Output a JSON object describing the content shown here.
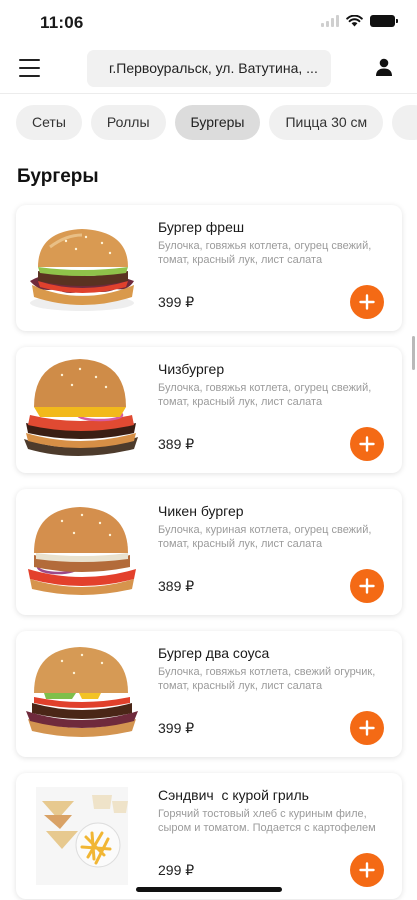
{
  "status_bar": {
    "time": "11:06",
    "icons": [
      "signal-icon",
      "wifi-icon",
      "battery-icon"
    ]
  },
  "header": {
    "menu_icon": "hamburger-menu-icon",
    "address": "г.Первоуральск, ул. Ватутина, ...",
    "profile_icon": "user-icon"
  },
  "categories": [
    {
      "label": "Сеты",
      "active": false
    },
    {
      "label": "Роллы",
      "active": false
    },
    {
      "label": "Бургеры",
      "active": true
    },
    {
      "label": "Пицца 30 см",
      "active": false
    },
    {
      "label": "",
      "active": false
    }
  ],
  "section": {
    "title": "Бургеры"
  },
  "products": [
    {
      "name": "Бургер фреш",
      "description": "Булочка, говяжья котлета, огурец свежий, томат, красный лук, лист салата",
      "price": "399 ₽",
      "image": "burger-photo"
    },
    {
      "name": "Чизбургер",
      "description": "Булочка, говяжья котлета, огурец свежий, томат, красный лук, лист салата",
      "price": "389 ₽",
      "image": "cheeseburger-photo"
    },
    {
      "name": "Чикен бургер",
      "description": "Булочка, куриная котлета, огурец свежий, томат, красный лук, лист салата",
      "price": "389 ₽",
      "image": "chicken-burger-photo"
    },
    {
      "name": "Бургер два соуса",
      "description": "Булочка, говяжья котлета, свежий огурчик, томат, красный лук, лист салата",
      "price": "399 ₽",
      "image": "two-sauce-burger-photo"
    },
    {
      "name": "Сэндвич  с курой гриль",
      "description": "Горячий тостовый хлеб с куриным филе, сыром и томатом. Подается с картофелем фри",
      "price": "299 ₽",
      "image": "sandwich-fries-photo"
    }
  ],
  "colors": {
    "accent": "#f46a15",
    "chip_bg": "#f0f0f0",
    "chip_active_bg": "#dcdcdc",
    "muted_text": "#9b9b9b"
  }
}
